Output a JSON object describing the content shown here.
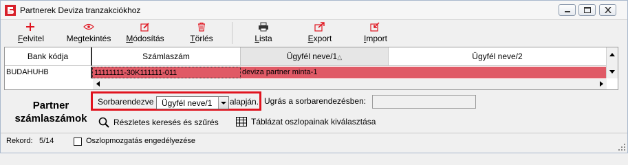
{
  "window": {
    "title": "Partnerek Deviza tranzakciókhoz"
  },
  "toolbar": {
    "new_label": "Felvitel",
    "new_underline": "F",
    "view_label": "Megtekintés",
    "view_underline": "",
    "edit_label": "Módosítás",
    "edit_underline": "M",
    "delete_label": "Törlés",
    "delete_underline": "T",
    "list_label": "Lista",
    "list_underline": "L",
    "export_label": "Export",
    "export_underline": "E",
    "import_label": "Import",
    "import_underline": "I"
  },
  "grid": {
    "columns": [
      "Bank kódja",
      "Számlaszám",
      "Ügyfél neve/1",
      "Ügyfél neve/2"
    ],
    "sort_indicator": "△",
    "rows": [
      {
        "bank": "BUDAHUHB",
        "account": "11111111-30K111111-011",
        "name1": "deviza partner minta-1",
        "name2": ""
      }
    ]
  },
  "panel": {
    "title_line1": "Partner",
    "title_line2": "számlaszámok",
    "sort_label": "Sorbarendezve",
    "sort_value": "Ügyfél neve/1",
    "sort_suffix": "alapján.",
    "jump_label": "Ugrás a sorbarendezésben:",
    "jump_value": "",
    "search_link": "Részletes keresés és szűrés",
    "columns_link": "Táblázat oszlopainak kiválasztása"
  },
  "status": {
    "record_label": "Rekord:",
    "record_value": "5/14",
    "move_columns_label": "Oszlopmozgatás engedélyezése",
    "move_columns_checked": false
  },
  "colors": {
    "row_highlight": "#e05a66",
    "accent_red": "#e0141f"
  }
}
